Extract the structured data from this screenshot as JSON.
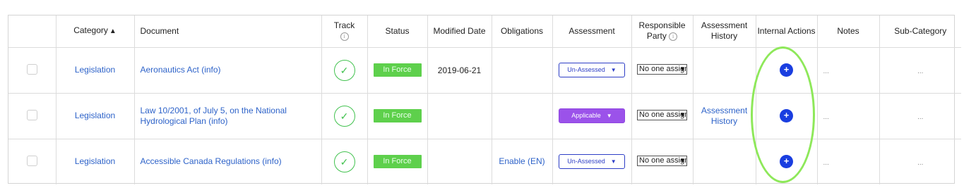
{
  "columns": {
    "select": "",
    "category": "Category",
    "category_sort": "▲",
    "document": "Document",
    "track": "Track",
    "status": "Status",
    "modified_date": "Modified Date",
    "obligations": "Obligations",
    "assessment": "Assessment",
    "responsible_party": "Responsible Party",
    "assessment_history": "Assessment History",
    "internal_actions": "Internal Actions",
    "notes": "Notes",
    "sub_category": "Sub-Category"
  },
  "info_glyph": "i",
  "rows": [
    {
      "category": "Legislation",
      "document": "Aeronautics Act (info)",
      "track_icon": "✓",
      "status": "In Force",
      "modified_date": "2019-06-21",
      "obligations": "",
      "assessment": "Un-Assessed",
      "assessment_style": "unassessed",
      "responsible_party": "No one assigned",
      "assessment_history": "",
      "internal_action": "+",
      "notes": "...",
      "sub_category": "..."
    },
    {
      "category": "Legislation",
      "document": "Law 10/2001, of July 5, on the National Hydrological Plan (info)",
      "track_icon": "✓",
      "status": "In Force",
      "modified_date": "",
      "obligations": "",
      "assessment": "Applicable",
      "assessment_style": "applicable",
      "responsible_party": "No one assigned",
      "assessment_history": "Assessment History",
      "internal_action": "+",
      "notes": "...",
      "sub_category": "..."
    },
    {
      "category": "Legislation",
      "document": "Accessible Canada Regulations (info)",
      "track_icon": "✓",
      "status": "In Force",
      "modified_date": "",
      "obligations": "Enable (EN)",
      "assessment": "Un-Assessed",
      "assessment_style": "unassessed",
      "responsible_party": "No one assigned",
      "assessment_history": "",
      "internal_action": "+",
      "notes": "...",
      "sub_category": "..."
    }
  ],
  "colors": {
    "link": "#2e63c9",
    "status_green": "#5ed04c",
    "unassessed_blue": "#2d3ec6",
    "applicable_purple": "#9b52ea",
    "action_blue": "#1a3ee0",
    "highlight_green": "#8ee85a"
  }
}
